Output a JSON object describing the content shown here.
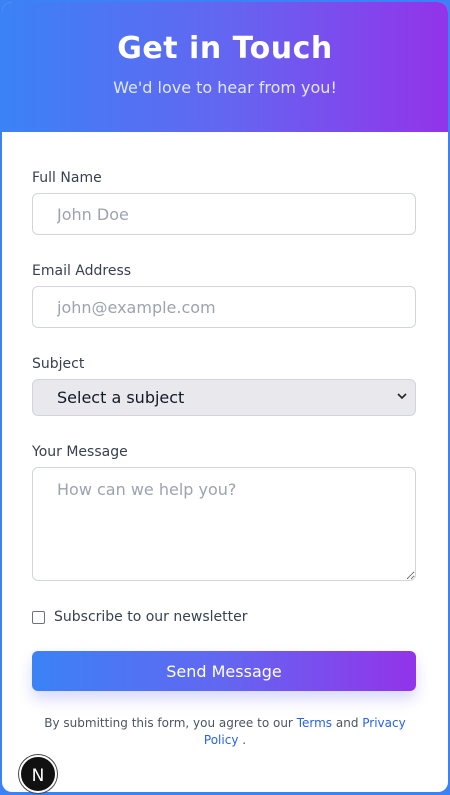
{
  "header": {
    "title": "Get in Touch",
    "subtitle": "We'd love to hear from you!"
  },
  "form": {
    "full_name": {
      "label": "Full Name",
      "placeholder": "John Doe"
    },
    "email": {
      "label": "Email Address",
      "placeholder": "john@example.com"
    },
    "subject": {
      "label": "Subject",
      "selected": "Select a subject"
    },
    "message": {
      "label": "Your Message",
      "placeholder": "How can we help you?"
    },
    "newsletter": {
      "label": "Subscribe to our newsletter",
      "checked": false
    },
    "submit_label": "Send Message"
  },
  "terms": {
    "prefix": "By submitting this form, you agree to our",
    "terms_link": "Terms",
    "and": "and",
    "privacy_link": "Privacy Policy",
    "suffix": "."
  },
  "badge": {
    "letter": "N"
  },
  "colors": {
    "gradient_start": "#3b82f6",
    "gradient_end": "#9333ea",
    "link": "#2563eb"
  }
}
